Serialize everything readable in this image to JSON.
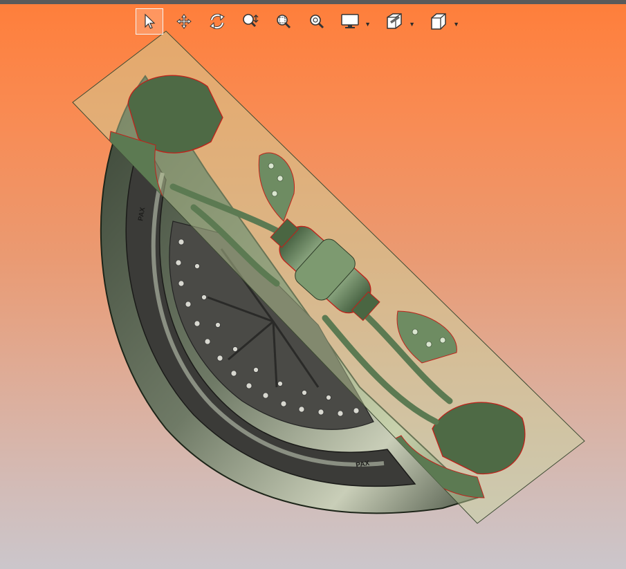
{
  "app": {
    "accent": "#ff7e3a",
    "section_plane_color": "#c8d6a0"
  },
  "toolbar": {
    "tools": [
      {
        "id": "select",
        "icon": "select-arrow-icon",
        "active": true
      },
      {
        "id": "pan",
        "icon": "pan-icon",
        "active": false
      },
      {
        "id": "rotate",
        "icon": "rotate-icon",
        "active": false
      },
      {
        "id": "zoom",
        "icon": "zoom-icon",
        "active": false
      },
      {
        "id": "zoom-window",
        "icon": "zoom-window-icon",
        "active": false
      },
      {
        "id": "zoom-fit",
        "icon": "zoom-fit-icon",
        "active": false
      },
      {
        "id": "display-mode",
        "icon": "monitor-icon",
        "dropdown": true
      },
      {
        "id": "section-view",
        "icon": "section-box-icon",
        "dropdown": true
      },
      {
        "id": "view-orientation",
        "icon": "cube-icon",
        "dropdown": true
      }
    ]
  },
  "viewport": {
    "model": "motorcycle-wheel-assembly",
    "section_cut": true
  }
}
